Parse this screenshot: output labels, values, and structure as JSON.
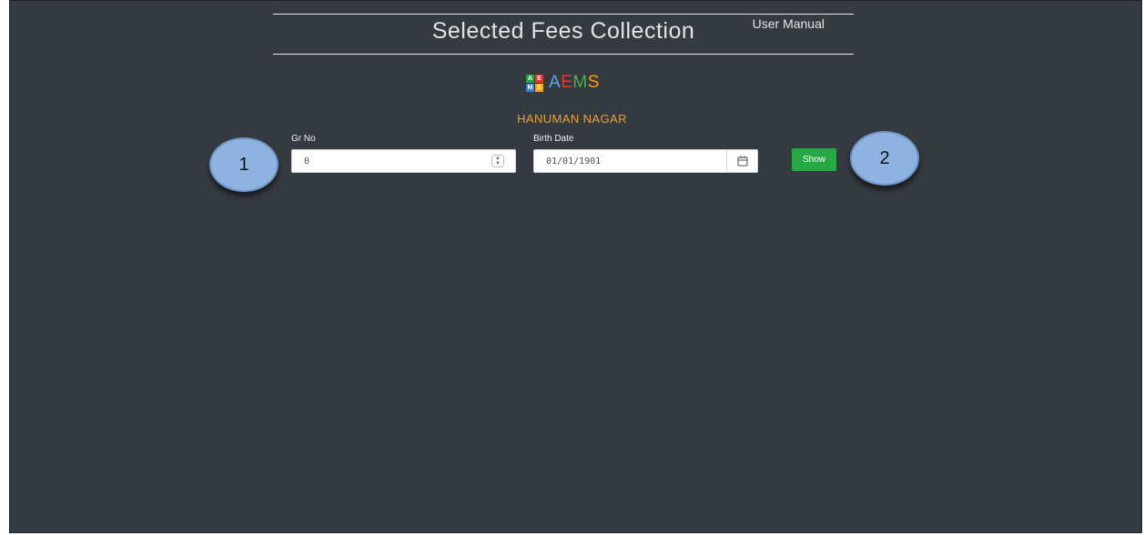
{
  "header": {
    "title": "Selected Fees Collection",
    "user_manual": "User Manual"
  },
  "logo": {
    "grid": [
      "A",
      "E",
      "M",
      "S"
    ],
    "grid_colors": [
      "#2e9e4a",
      "#e2372b",
      "#3a7dd8",
      "#f2a21b"
    ],
    "text": [
      {
        "char": "A",
        "color": "#5aa6f0"
      },
      {
        "char": "E",
        "color": "#e2372b"
      },
      {
        "char": "M",
        "color": "#4caf50"
      },
      {
        "char": "S",
        "color": "#f2a21b"
      }
    ]
  },
  "organization": "HANUMAN NAGAR",
  "form": {
    "gr_no": {
      "label": "Gr No",
      "value": "0"
    },
    "birth_date": {
      "label": "Birth Date",
      "value": "01/01/1901"
    },
    "show_label": "Show"
  },
  "annotations": [
    "1",
    "2"
  ],
  "colors": {
    "background": "#343a40",
    "accent": "#e6a23c",
    "button": "#28a745",
    "bubble": "#8eb3e0"
  }
}
